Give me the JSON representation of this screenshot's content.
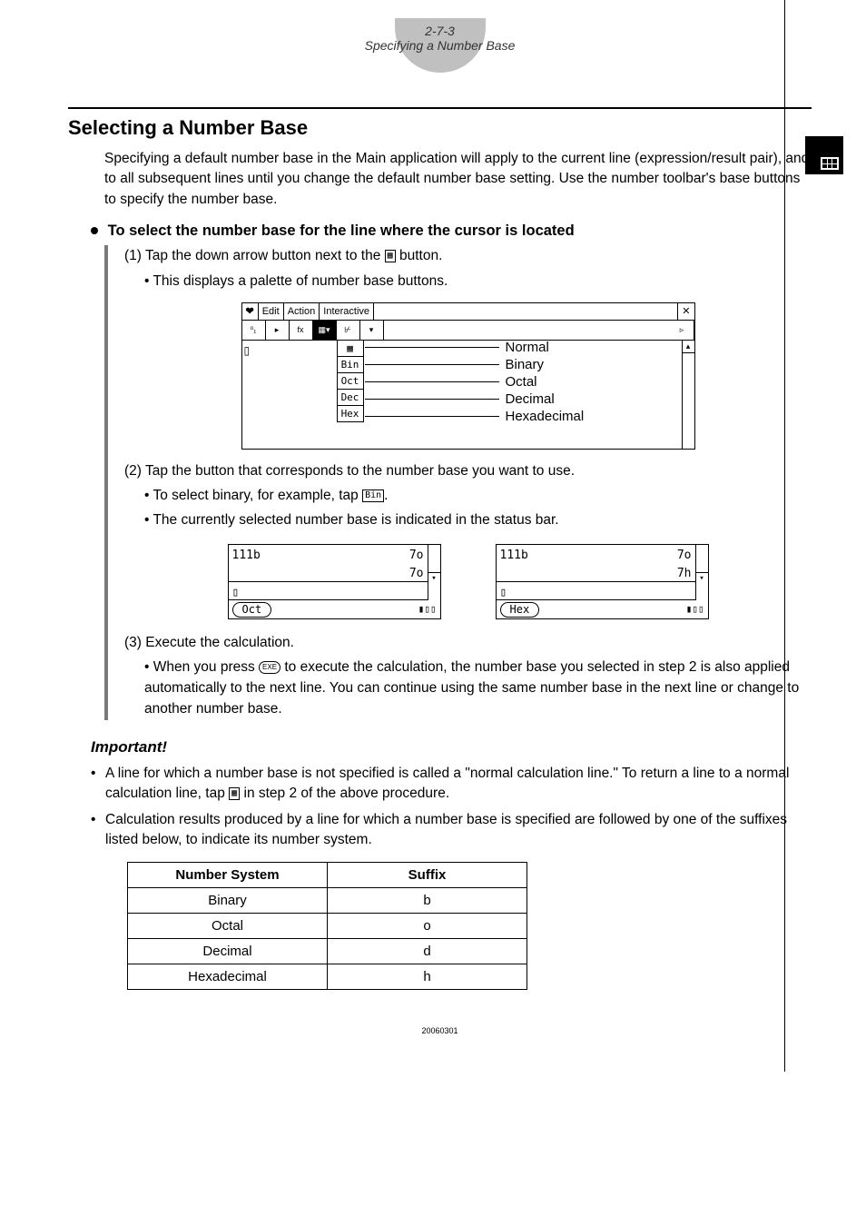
{
  "header": {
    "section_number": "2-7-3",
    "section_title": "Specifying a Number Base"
  },
  "title": "Selecting a Number Base",
  "intro": "Specifying a default number base in the Main application will apply to the current line (expression/result pair), and to all subsequent lines until you change the default number base setting. Use the number toolbar's base buttons to specify the number base.",
  "procedure_heading": "To select the number base for the line where the cursor is located",
  "steps": {
    "s1": "(1) Tap the down arrow button next to the",
    "s1_end": "button.",
    "s1_sub": "This displays a palette of number base buttons.",
    "s2": "(2) Tap the button that corresponds to the number base you want to use.",
    "s2_sub1a": "To select binary, for example, tap",
    "s2_sub1b": ".",
    "s2_sub2": "The currently selected number base is indicated in the status bar.",
    "s3": "(3) Execute the calculation.",
    "s3_sub_a": "When you press",
    "s3_sub_b": "to execute the calculation, the number base you selected in step 2 is also applied automatically to the next line. You can continue using the same number base in the next line or change to another number base."
  },
  "menubar": {
    "items": [
      "Edit",
      "Action",
      "Interactive"
    ],
    "close": "✕"
  },
  "palette": {
    "items": [
      "Bin",
      "Oct",
      "Dec",
      "Hex"
    ],
    "labels": [
      "Normal",
      "Binary",
      "Octal",
      "Decimal",
      "Hexadecimal"
    ]
  },
  "panels": {
    "left": {
      "input": "111b",
      "r1": "7o",
      "r2": "7o",
      "status": "Oct"
    },
    "right": {
      "input": "111b",
      "r1": "7o",
      "r2": "7h",
      "status": "Hex"
    }
  },
  "important": {
    "heading": "Important!",
    "note1a": "A line for which a number base is not specified is called a \"normal calculation line.\" To return a line to a normal calculation line, tap",
    "note1b": "in step 2 of the above procedure.",
    "note2": "Calculation results produced by a line for which a number base is specified are followed by one of the suffixes listed below, to indicate its number system."
  },
  "table": {
    "headers": [
      "Number System",
      "Suffix"
    ],
    "rows": [
      [
        "Binary",
        "b"
      ],
      [
        "Octal",
        "o"
      ],
      [
        "Decimal",
        "d"
      ],
      [
        "Hexadecimal",
        "h"
      ]
    ]
  },
  "exe_label": "EXE",
  "bin_label": "Bin",
  "footer": "20060301"
}
